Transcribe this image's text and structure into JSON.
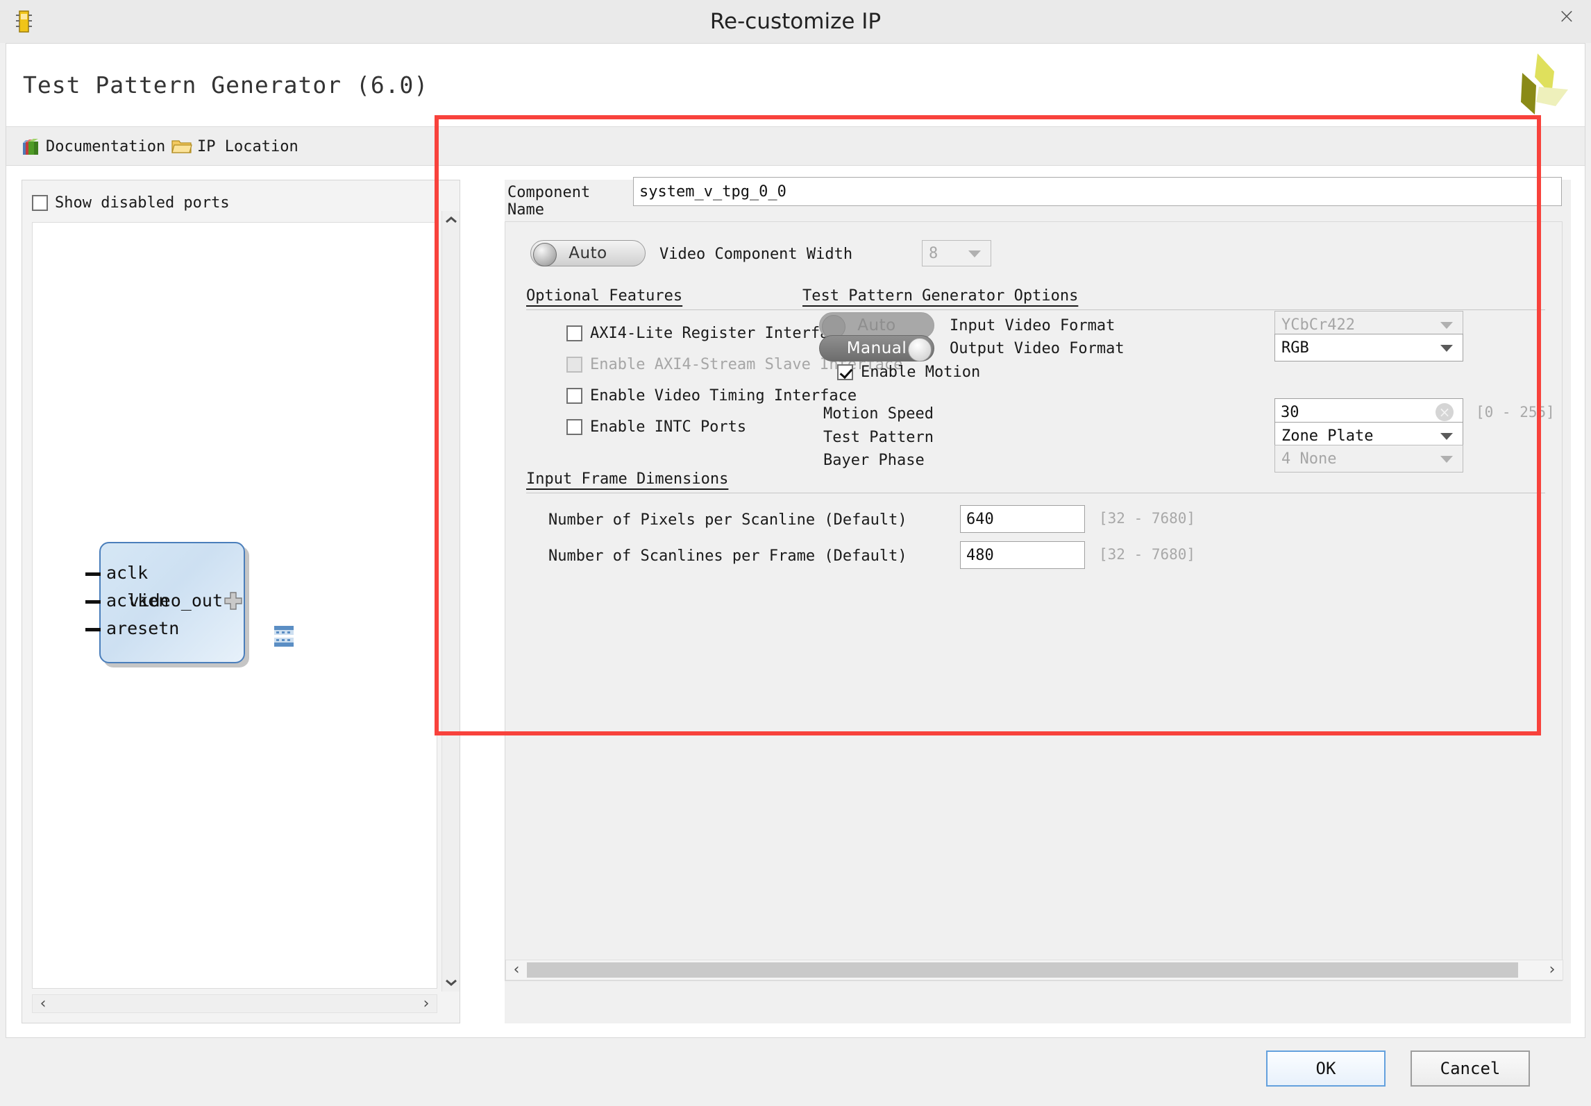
{
  "window": {
    "title": "Re-customize IP",
    "close_label": "×",
    "icon_name": "ip-chip-icon"
  },
  "header": {
    "ip_title": "Test Pattern Generator (6.0)",
    "logo_name": "xilinx-logo"
  },
  "linkbar": {
    "documentation": "Documentation",
    "ip_location": "IP Location"
  },
  "left_panel": {
    "show_disabled_ports": {
      "label": "Show disabled ports",
      "checked": false
    },
    "block": {
      "input_ports": [
        "aclk",
        "aclken",
        "aresetn"
      ],
      "output_port": "video_out",
      "expander": "+"
    },
    "scroll": {
      "up": "ⱏ",
      "down": "ⱟ",
      "left": "‹",
      "right": "›"
    }
  },
  "form": {
    "component_name_label": "Component Name",
    "component_name_value": "system_v_tpg_0_0",
    "video_component_width": {
      "toggle_label": "Auto",
      "toggle_state": "auto",
      "label": "Video Component Width",
      "value": "8",
      "enabled": false
    },
    "optional_features": {
      "header": "Optional Features",
      "items": [
        {
          "label": "AXI4-Lite Register Interface",
          "checked": false,
          "enabled": true
        },
        {
          "label": "Enable AXI4-Stream Slave Interface",
          "checked": false,
          "enabled": false
        },
        {
          "label": "Enable Video Timing Interface",
          "checked": false,
          "enabled": true
        },
        {
          "label": "Enable INTC Ports",
          "checked": false,
          "enabled": true
        }
      ]
    },
    "tpg_options": {
      "header": "Test Pattern Generator Options",
      "input_video_format": {
        "toggle_label": "Auto",
        "toggle_state": "disabled",
        "label": "Input Video Format",
        "value": "YCbCr422",
        "enabled": false
      },
      "output_video_format": {
        "toggle_label": "Manual",
        "toggle_state": "manual",
        "label": "Output Video Format",
        "value": "RGB",
        "enabled": true
      },
      "enable_motion": {
        "label": "Enable Motion",
        "checked": true
      },
      "motion_speed": {
        "label": "Motion Speed",
        "value": "30",
        "range": "[0 - 255]",
        "clear_glyph": "×"
      },
      "test_pattern": {
        "label": "Test Pattern",
        "value": "Zone Plate",
        "enabled": true
      },
      "bayer_phase": {
        "label": "Bayer Phase",
        "value": "4 None",
        "enabled": false
      }
    },
    "input_frame_dimensions": {
      "header": "Input Frame Dimensions",
      "pixels_per_scanline": {
        "label": "Number of Pixels per Scanline (Default)",
        "value": "640",
        "range": "[32 - 7680]"
      },
      "scanlines_per_frame": {
        "label": "Number of Scanlines per Frame (Default)",
        "value": "480",
        "range": "[32 - 7680]"
      }
    },
    "scroll": {
      "left": "‹",
      "right": "›"
    }
  },
  "footer": {
    "ok": "OK",
    "cancel": "Cancel"
  },
  "colors": {
    "accent_red": "#f8423c",
    "ok_border": "#63a0dd",
    "block_border": "#4a7ebb"
  }
}
